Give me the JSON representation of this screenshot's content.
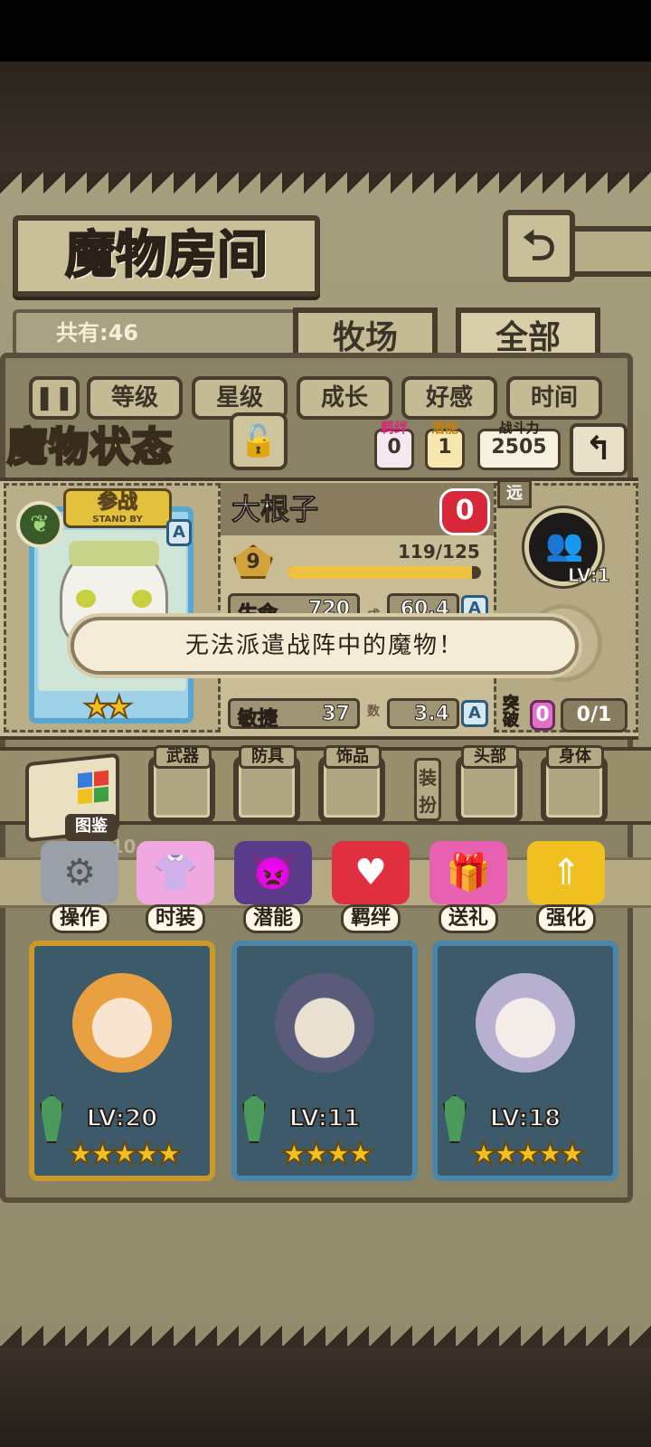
{
  "header": {
    "title": "魔物房间",
    "back_icon": "return-arrow-icon"
  },
  "collection": {
    "count_text": "共有:46"
  },
  "tabs": [
    {
      "label": "牧场"
    },
    {
      "label": "全部"
    }
  ],
  "sort": {
    "toggle_icon": "pause-icon",
    "options": [
      {
        "label": "等级"
      },
      {
        "label": "星级"
      },
      {
        "label": "成长"
      },
      {
        "label": "好感"
      },
      {
        "label": "时间"
      }
    ]
  },
  "status": {
    "section_title": "魔物状态",
    "lock_icon": "padlock-icon",
    "bond": {
      "label": "羁绊",
      "value": "0"
    },
    "potential": {
      "label": "潜能",
      "value": "1"
    },
    "power": {
      "label": "战斗力",
      "value": "2505"
    },
    "back_icon": "return-arrow-icon"
  },
  "monster": {
    "name": "大根子",
    "affection": "0",
    "standby": {
      "label": "参战",
      "sub": "STAND BY"
    },
    "element_icon": "leaf-icon",
    "rank": "A",
    "stars": 2,
    "level": "9",
    "exp_text": "119/125",
    "exp_fraction": 0.952,
    "stats": [
      {
        "label": "生命",
        "value": "720",
        "coef": "60.4",
        "grade": "A"
      },
      {
        "label": "敏捷",
        "value": "37",
        "coef": "3.4",
        "grade": "A"
      }
    ],
    "coef_label_top": "成",
    "coef_label_bottom": "数"
  },
  "formation": {
    "range": "远",
    "level": "LV:1",
    "break_label": "突破",
    "break_value": "0",
    "break_progress": "0/1"
  },
  "toast": {
    "message": "无法派遣战阵中的魔物！"
  },
  "equipment": {
    "book_label": "图鉴",
    "dress_label": "装扮",
    "slots": [
      {
        "label": "武器"
      },
      {
        "label": "防具"
      },
      {
        "label": "饰品"
      },
      {
        "label": "头部"
      },
      {
        "label": "身体"
      }
    ]
  },
  "actions": [
    {
      "label": "操作",
      "icon": "gear-icon"
    },
    {
      "label": "时装",
      "icon": "clothing-icon"
    },
    {
      "label": "潜能",
      "icon": "demon-icon"
    },
    {
      "label": "羁绊",
      "icon": "hearts-icon"
    },
    {
      "label": "送礼",
      "icon": "gift-icon"
    },
    {
      "label": "强化",
      "icon": "upgrade-arrows-icon"
    }
  ],
  "roster": [
    {
      "level": "LV:20",
      "stars": 5
    },
    {
      "level": "LV:11",
      "stars": 4
    },
    {
      "level": "LV:18",
      "stars": 5
    }
  ],
  "colors": {
    "accent": "#f2c020",
    "heart": "#d8283a",
    "rank_blue": "#2c5c80"
  }
}
